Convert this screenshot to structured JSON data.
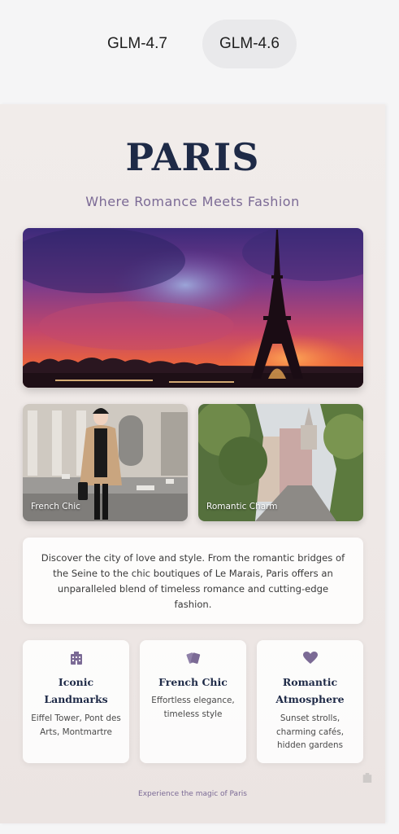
{
  "tabs": [
    {
      "label": "GLM-4.7",
      "selected": false
    },
    {
      "label": "GLM-4.6",
      "selected": true
    }
  ],
  "page": {
    "title": "PARIS",
    "subtitle": "Where Romance Meets Fashion",
    "photos": [
      {
        "caption": "French Chic"
      },
      {
        "caption": "Romantic Charm"
      }
    ],
    "intro": "Discover the city of love and style. From the romantic bridges of the Seine to the chic boutiques of Le Marais, Paris offers an unparalleled blend of timeless romance and cutting-edge fashion.",
    "features": [
      {
        "icon": "building-icon",
        "title": "Iconic Landmarks",
        "desc": "Eiffel Tower, Pont des Arts, Montmartre"
      },
      {
        "icon": "palette-icon",
        "title": "French Chic",
        "desc": "Effortless elegance, timeless style"
      },
      {
        "icon": "heart-icon",
        "title": "Romantic Atmosphere",
        "desc": "Sunset strolls, charming cafés, hidden gardens"
      }
    ],
    "footer": "Experience the magic of Paris"
  },
  "colors": {
    "title": "#1e2a47",
    "accent": "#7b6a95",
    "selected_tab_bg": "#e9e9eb"
  }
}
